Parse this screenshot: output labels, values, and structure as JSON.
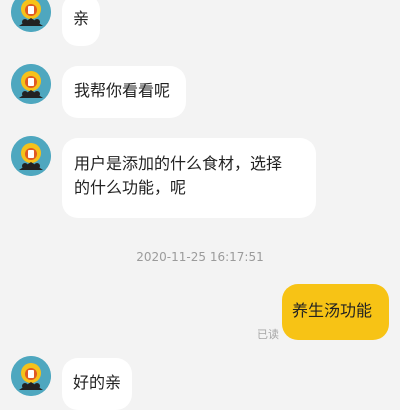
{
  "messages": {
    "m1": "亲",
    "m2": "我帮你看看呢",
    "m3_line1": "用户是添加的什么食材，选择",
    "m3_line2": "的什么功能，呢",
    "user_msg": "养生汤功能",
    "m4": "好的亲"
  },
  "timestamp": "2020-11-25 16:17:51",
  "read_status": "已读",
  "icons": {
    "avatar": "sunflower-mascot-icon"
  },
  "colors": {
    "background": "#f3f3f3",
    "incoming_bubble": "#ffffff",
    "outgoing_bubble": "#f7c315",
    "avatar_bg": "#4ea7bf"
  }
}
